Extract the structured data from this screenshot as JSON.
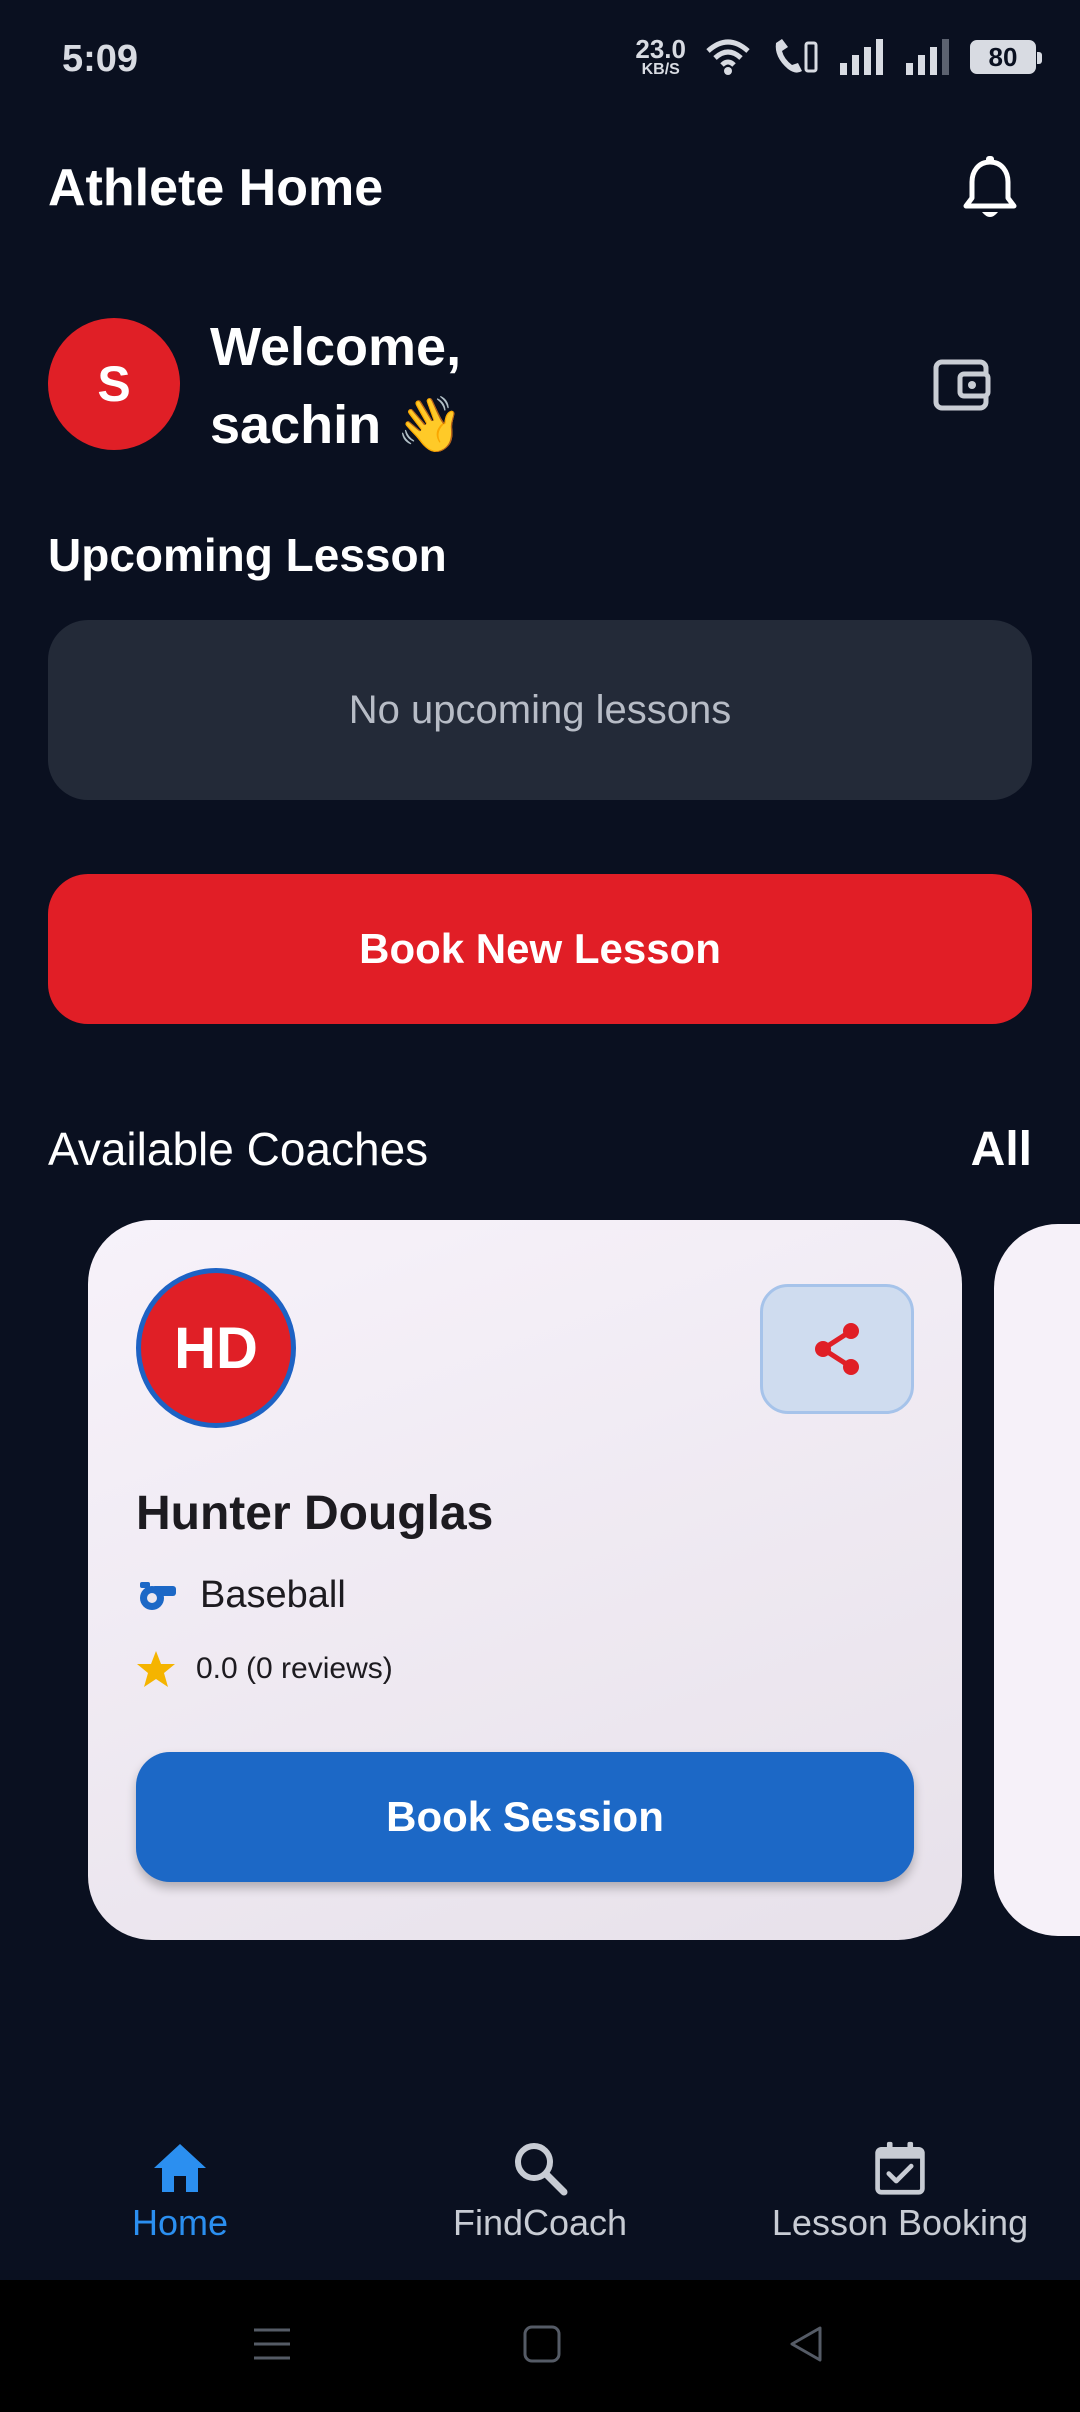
{
  "status_bar": {
    "time": "5:09",
    "net_speed_value": "23.0",
    "net_speed_unit": "KB/S",
    "battery": "80"
  },
  "header": {
    "title": "Athlete Home"
  },
  "user": {
    "avatar_initial": "S",
    "welcome_line1": "Welcome,",
    "welcome_line2": "sachin 👋"
  },
  "upcoming": {
    "title": "Upcoming Lesson",
    "empty_text": "No upcoming lessons"
  },
  "book_new_label": "Book New Lesson",
  "coaches": {
    "title": "Available Coaches",
    "all_label": "All",
    "items": [
      {
        "initials": "HD",
        "name": "Hunter Douglas",
        "sport": "Baseball",
        "rating": "0.0 (0 reviews)",
        "book_label": "Book Session"
      }
    ]
  },
  "nav": {
    "items": [
      {
        "label": "Home",
        "icon": "home-icon",
        "active": true
      },
      {
        "label": "FindCoach",
        "icon": "search-icon",
        "active": false
      },
      {
        "label": "Lesson Booking",
        "icon": "calendar-check-icon",
        "active": false
      }
    ]
  },
  "colors": {
    "background": "#0a1020",
    "accent_red": "#e11e26",
    "accent_blue": "#1c68c6",
    "nav_active": "#2b8ff0",
    "star": "#f5b400"
  }
}
